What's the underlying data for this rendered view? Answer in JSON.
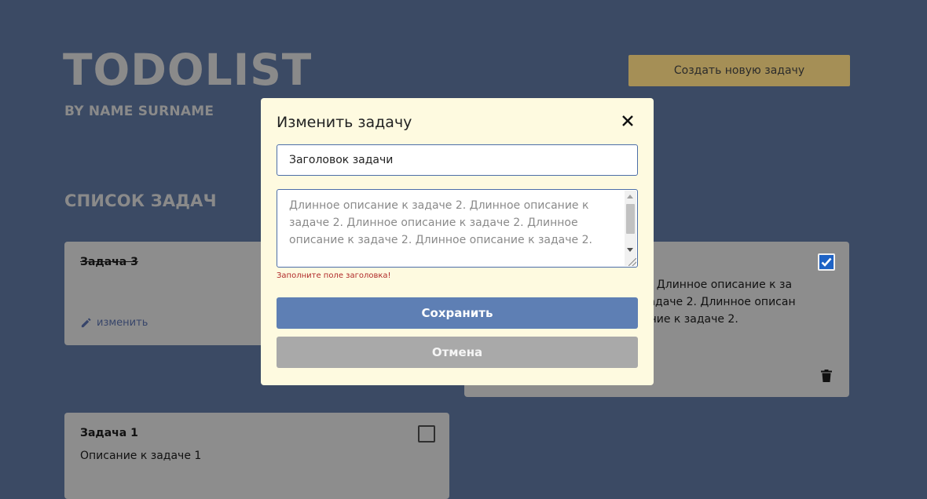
{
  "header": {
    "title": "TODOLIST",
    "subtitle": "BY NAME SURNAME",
    "create_button": "Создать новую задачу"
  },
  "section": {
    "title": "СПИСОК ЗАДАЧ"
  },
  "cards": [
    {
      "title": "Задача 3",
      "completed": true,
      "edit_label": "изменить",
      "icons": [
        "pencil-icon"
      ]
    },
    {
      "description_visible": "2. Длинное описание к за\nзадаче 2. Длинное описан\nание к задаче 2.",
      "checked": true,
      "icons": [
        "checkbox-checked-icon",
        "trash-icon"
      ]
    },
    {
      "title": "Задача 1",
      "description": "Описание к задаче 1",
      "checked": false,
      "icons": [
        "checkbox-unchecked-icon"
      ]
    }
  ],
  "modal": {
    "title": "Изменить задачу",
    "close_icon": "close-icon",
    "title_input_value": "Заголовок задачи",
    "description_value": "Длинное описание к задаче 2. Длинное описание к задаче 2. Длинное описание к задаче 2. Длинное описание к задаче 2. Длинное описание к задаче 2.",
    "error": "Заполните поле заголовка!",
    "save_label": "Сохранить",
    "cancel_label": "Отмена"
  },
  "colors": {
    "background": "#3b4a64",
    "card": "#8d8d8d",
    "accent_button": "#a58f56",
    "modal": "#fefae0",
    "primary": "#5e7fb4",
    "secondary": "#a9a9a9",
    "error": "#b02a2a",
    "checkbox_checked": "#1f63c5"
  }
}
